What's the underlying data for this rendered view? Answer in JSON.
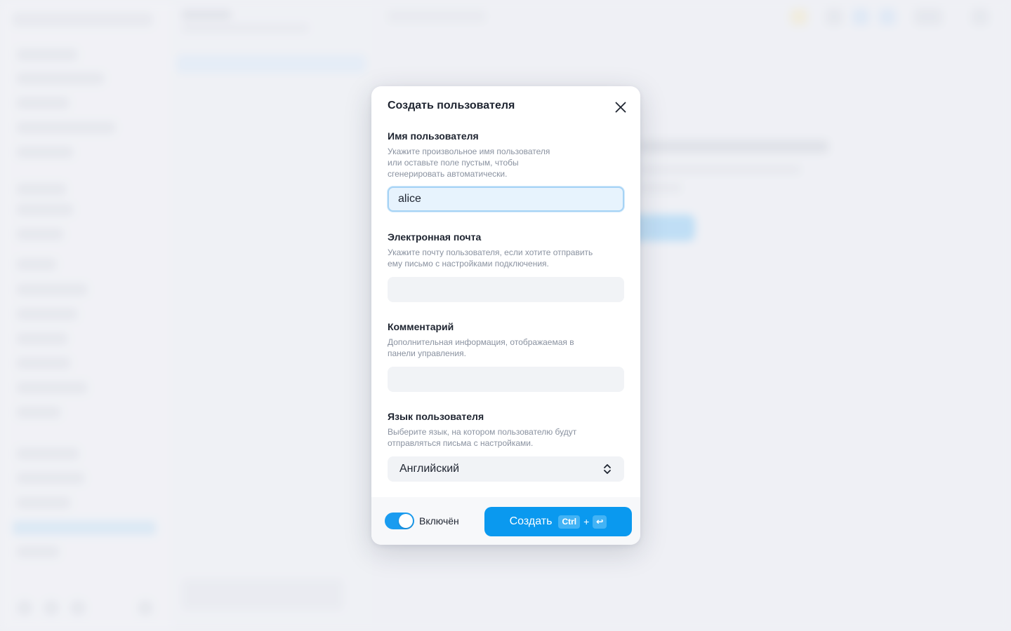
{
  "modal": {
    "title": "Создать пользователя",
    "close_icon": "close-icon"
  },
  "fields": {
    "username": {
      "label": "Имя пользователя",
      "hint_lines": [
        "Укажите произвольное имя пользователя",
        "или оставьте поле пустым, чтобы",
        "сгенерировать автоматически."
      ],
      "value": "alice"
    },
    "email": {
      "label": "Электронная почта",
      "hint_lines": [
        "Укажите почту пользователя, если хотите отправить",
        "ему письмо с настройками подключения."
      ],
      "value": ""
    },
    "comment": {
      "label": "Комментарий",
      "hint_lines": [
        "Дополнительная информация, отображаемая в",
        "панели управления."
      ],
      "value": ""
    },
    "language": {
      "label": "Язык пользователя",
      "hint_lines": [
        "Выберите язык, на котором пользователю будут",
        "отправляться письма с настройками."
      ],
      "selected": "Английский"
    }
  },
  "footer": {
    "toggle_label": "Включён",
    "toggle_on": true,
    "create_label": "Создать",
    "shortcut_ctrl": "Ctrl",
    "shortcut_plus": "+",
    "shortcut_enter": "↩"
  },
  "colors": {
    "accent": "#0a99ef",
    "toggle": "#1a9cf0",
    "focus_border": "#a6d3f5"
  }
}
